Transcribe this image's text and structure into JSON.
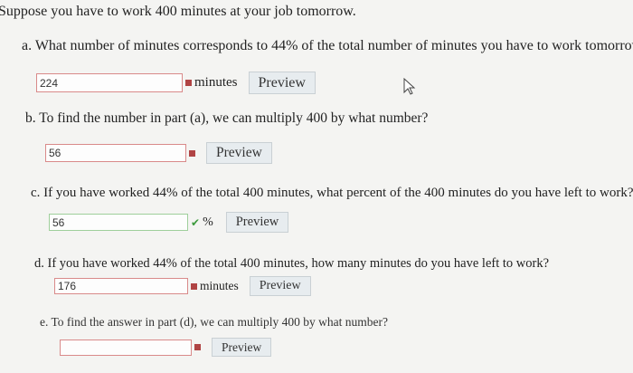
{
  "intro": "Suppose you have to work 400 minutes at your job tomorrow.",
  "questions": {
    "a": {
      "text": "a. What number of minutes corresponds to 44% of the total number of minutes you have to work tomorrow",
      "answer": "224",
      "unit": "minutes",
      "preview": "Preview"
    },
    "b": {
      "text": "b. To find the number in part (a), we can multiply 400 by what number?",
      "answer": "56",
      "preview": "Preview"
    },
    "c": {
      "text": "c. If you have worked 44% of the total 400 minutes, what percent of the 400 minutes do you have left to work?",
      "answer": "56",
      "unit": "%",
      "preview": "Preview"
    },
    "d": {
      "text": "d. If you have worked 44% of the total 400 minutes, how many minutes do you have left to work?",
      "answer": "176",
      "unit": "minutes",
      "preview": "Preview"
    },
    "e": {
      "text": "e. To find the answer in part (d), we can multiply 400 by what number?",
      "answer": "",
      "preview": "Preview"
    }
  },
  "icons": {
    "incorrect": "incorrect-mark-icon",
    "correct": "check-mark-icon",
    "cursor": "mouse-cursor-icon"
  },
  "colors": {
    "incorrect_border": "#d98a8a",
    "correct_border": "#9fcf9b",
    "incorrect_mark": "#b04444",
    "correct_mark": "#3c9a3c",
    "preview_bg": "#e7ecef"
  }
}
